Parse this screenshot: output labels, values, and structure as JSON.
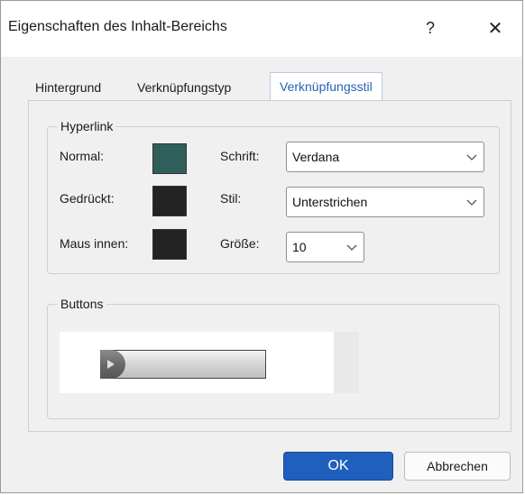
{
  "dialog": {
    "title": "Eigenschaften des Inhalt-Bereichs",
    "help_glyph": "?",
    "close_glyph": "✕"
  },
  "tabs": [
    {
      "label": "Hintergrund",
      "active": false
    },
    {
      "label": "Verknüpfungstyp",
      "active": false
    },
    {
      "label": "Verknüpfungsstil",
      "active": true
    }
  ],
  "hyperlink": {
    "legend": "Hyperlink",
    "normal_label": "Normal:",
    "pressed_label": "Gedrückt:",
    "hover_label": "Maus innen:",
    "normal_color": "#2f5f5a",
    "pressed_color": "#232323",
    "hover_color": "#232323",
    "font_label": "Schrift:",
    "font_value": "Verdana",
    "style_label": "Stil:",
    "style_value": "Unterstrichen",
    "size_label": "Größe:",
    "size_value": "10"
  },
  "buttons_group": {
    "legend": "Buttons"
  },
  "footer": {
    "ok_label": "OK",
    "cancel_label": "Abbrechen"
  },
  "colors": {
    "accent": "#1f5fbd",
    "active_tab_text": "#2863b8"
  },
  "icons": {
    "dropdown": "chevron-down-icon",
    "preview_play": "play-triangle-icon"
  }
}
